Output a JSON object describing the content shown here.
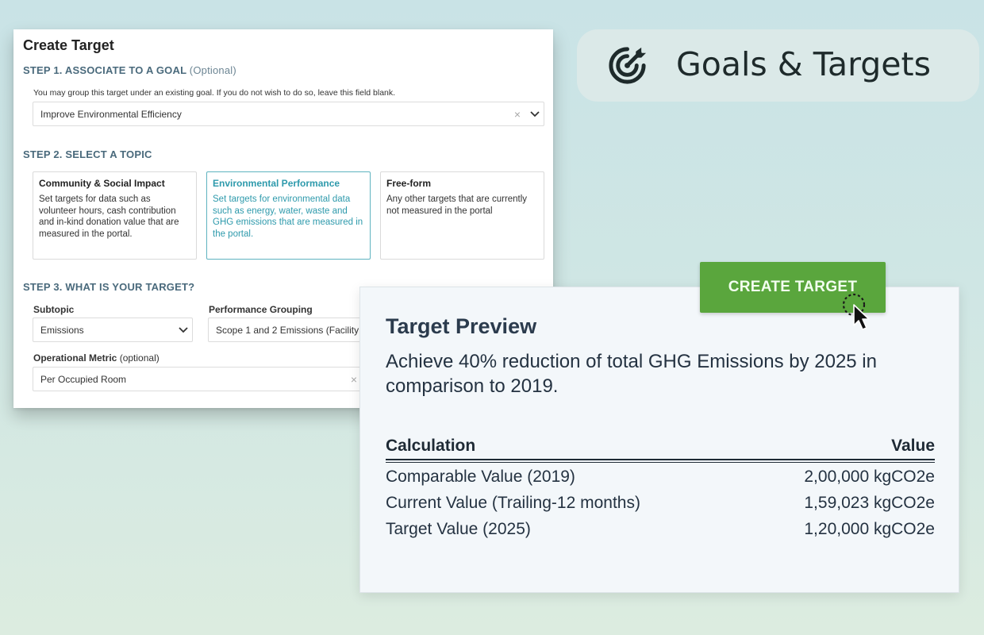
{
  "create_target": {
    "title": "Create Target",
    "step1": {
      "heading": "STEP 1. ASSOCIATE TO A GOAL",
      "optional": "(Optional)",
      "hint": "You may group this target under an existing goal. If you do not wish to do so, leave this field blank.",
      "goal_value": "Improve Environmental Efficiency",
      "clear_symbol": "×"
    },
    "step2": {
      "heading": "STEP 2. SELECT A TOPIC",
      "topics": [
        {
          "title": "Community & Social Impact",
          "desc": "Set targets for data such as volunteer hours, cash contribution and in-kind donation value that are measured in the portal."
        },
        {
          "title": "Environmental Performance",
          "desc": "Set targets for environmental data such as energy, water, waste and GHG emissions that are measured in the portal."
        },
        {
          "title": "Free-form",
          "desc": "Any other targets that are currently not measured in the portal"
        }
      ],
      "selected_index": 1
    },
    "step3": {
      "heading": "STEP 3. WHAT IS YOUR TARGET?",
      "subtopic_label": "Subtopic",
      "subtopic_value": "Emissions",
      "grouping_label": "Performance Grouping",
      "grouping_value": "Scope 1 and 2 Emissions (Facility",
      "metric_label": "Operational Metric",
      "metric_optional": "(optional)",
      "metric_value": "Per Occupied Room",
      "clear_symbol": "×"
    }
  },
  "goals_pill": {
    "title": "Goals & Targets",
    "icon": "target-arrow-icon"
  },
  "cta": {
    "label": "CREATE TARGET",
    "color": "#5aa63d"
  },
  "preview": {
    "title": "Target Preview",
    "summary": "Achieve 40% reduction of total GHG Emissions by 2025 in comparison to 2019.",
    "calc_header": "Calculation",
    "value_header": "Value",
    "rows": [
      {
        "label": "Comparable Value (2019)",
        "value": "2,00,000 kgCO2e"
      },
      {
        "label": "Current Value (Trailing-12 months)",
        "value": "1,59,023 kgCO2e"
      },
      {
        "label": "Target Value (2025)",
        "value": "1,20,000 kgCO2e"
      }
    ]
  },
  "colors": {
    "accent_teal": "#2e9aac",
    "heading_slate": "#4a6a7c",
    "button_green": "#5aa63d"
  }
}
